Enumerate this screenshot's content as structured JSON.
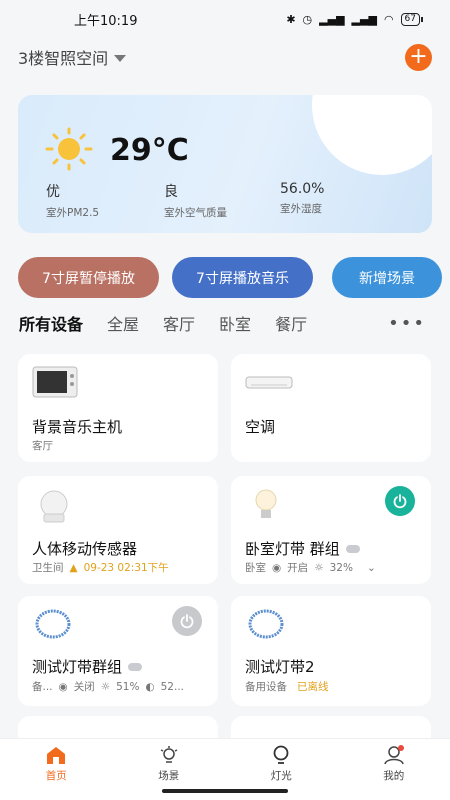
{
  "status": {
    "time": "上午10:19",
    "battery": "67"
  },
  "header": {
    "home_name": "3楼智照空间"
  },
  "weather": {
    "temperature": "29°C",
    "pm25_value": "优",
    "pm25_label": "室外PM2.5",
    "aqi_value": "良",
    "aqi_label": "室外空气质量",
    "humidity_value": "56.0%",
    "humidity_label": "室外湿度"
  },
  "actions": [
    {
      "label": "7寸屏暂停播放",
      "color": "#b87163"
    },
    {
      "label": "7寸屏播放音乐",
      "color": "#4570c8"
    },
    {
      "label": "新增场景",
      "color": "#3d93db"
    }
  ],
  "tabs": [
    "所有设备",
    "全屋",
    "客厅",
    "卧室",
    "餐厅"
  ],
  "devices": [
    {
      "name": "背景音乐主机",
      "room": "客厅"
    },
    {
      "name": "空调",
      "room": ""
    },
    {
      "name": "人体移动传感器",
      "room": "卫生间",
      "alert": "09-23 02:31下午"
    },
    {
      "name": "卧室灯带 群组",
      "room": "卧室",
      "state": "开启",
      "brightness": "32%"
    },
    {
      "name": "测试灯带群组",
      "room": "备...",
      "state": "关闭",
      "brightness": "51%",
      "temp": "52..."
    },
    {
      "name": "测试灯带2",
      "room": "备用设备",
      "offline": "已离线"
    }
  ],
  "nav": [
    {
      "label": "首页",
      "icon": "home-icon"
    },
    {
      "label": "场景",
      "icon": "scene-icon"
    },
    {
      "label": "灯光",
      "icon": "bulb-icon"
    },
    {
      "label": "我的",
      "icon": "user-icon"
    }
  ],
  "colors": {
    "accent": "#f26a1b",
    "power_on": "#18b39a",
    "power_off": "#c7c9cc",
    "alert": "#e0a21a"
  }
}
